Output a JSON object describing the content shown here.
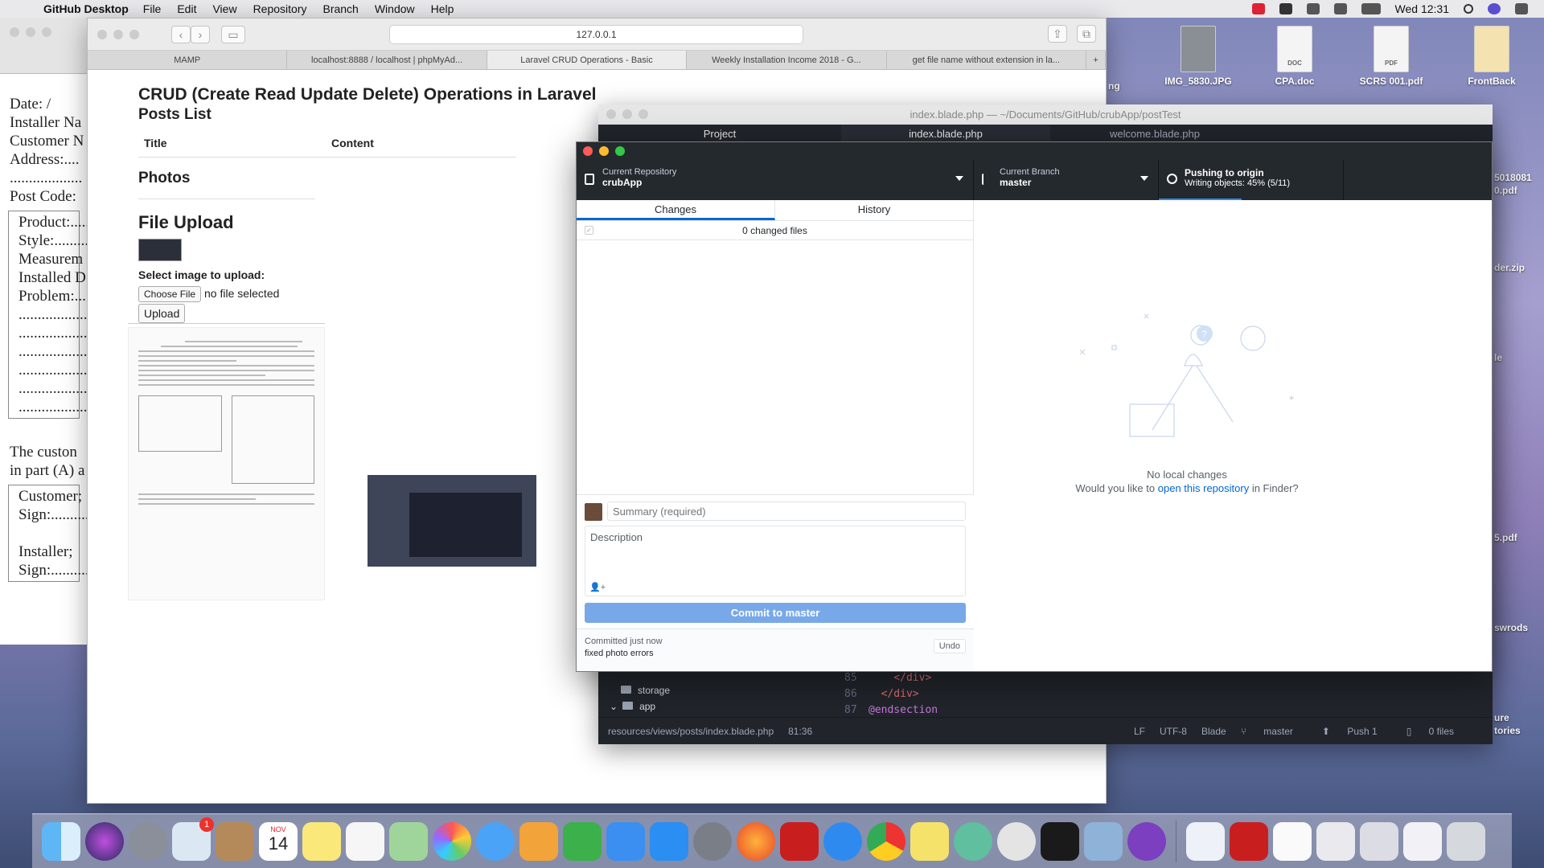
{
  "menubar": {
    "app_name": "GitHub Desktop",
    "menus": [
      "File",
      "Edit",
      "View",
      "Repository",
      "Branch",
      "Window",
      "Help"
    ],
    "clock": "Wed 12:31"
  },
  "desktop_icons": [
    {
      "label": "IMG_5830.JPG",
      "kind": "image"
    },
    {
      "label": "CPA.doc",
      "kind": "DOC"
    },
    {
      "label": "SCRS 001.pdf",
      "kind": "PDF"
    },
    {
      "label": "FrontBack",
      "kind": "app"
    }
  ],
  "desktop_edge_labels": [
    "ng",
    "5018081",
    "0.pdf",
    "der.zip",
    "le",
    "5.pdf",
    "swrods",
    "ure",
    "tories"
  ],
  "doc_window": {
    "lines_top": [
      "Date:     /",
      "Installer Na",
      "Customer N",
      "Address:....",
      "...................",
      "Post Code:"
    ],
    "lines_box": [
      "Product:.....",
      "Style:..........",
      "Measurem",
      "Installed D",
      "Problem:....",
      "...................",
      "...................",
      "...................",
      "...................",
      "...................",
      "..................."
    ],
    "lines_bottom": [
      "The custon",
      "in part (A) a"
    ],
    "lines_box2": [
      "Customer;",
      "Sign:............",
      "",
      "Installer;",
      "Sign:............"
    ]
  },
  "safari": {
    "url": "127.0.0.1",
    "tabs": [
      "MAMP",
      "localhost:8888 / localhost | phpMyAd...",
      "Laravel CRUD Operations - Basic",
      "Weekly Installation Income 2018 - G...",
      "get file name without extension in la..."
    ],
    "page": {
      "heading": "CRUD (Create Read Update Delete) Operations in Laravel",
      "posts_title": "Posts List",
      "col_title": "Title",
      "col_content": "Content",
      "photos_title": "Photos",
      "upload_title": "File Upload",
      "select_label": "Select image to upload:",
      "choose_button": "Choose File",
      "no_file": "no file selected",
      "upload_button": "Upload"
    }
  },
  "atom": {
    "title": "index.blade.php — ~/Documents/GitHub/crubApp/postTest",
    "tabs": [
      "Project",
      "index.blade.php",
      "welcome.blade.php"
    ],
    "tree": [
      "storage",
      "app"
    ],
    "code": [
      {
        "line": "85",
        "text": "    </div>"
      },
      {
        "line": "86",
        "text": "  </div>"
      },
      {
        "line": "87",
        "text": "@endsection"
      }
    ],
    "status": {
      "path": "resources/views/posts/index.blade.php",
      "cursor": "81:36",
      "eol": "LF",
      "encoding": "UTF-8",
      "grammar": "Blade",
      "branch": "master",
      "push": "Push 1",
      "files": "0 files"
    }
  },
  "github_desktop": {
    "repo_label": "Current Repository",
    "repo_value": "crubApp",
    "branch_label": "Current Branch",
    "branch_value": "master",
    "push_label": "Pushing to origin",
    "push_value": "Writing objects: 45% (5/11)",
    "push_progress_percent": 45,
    "tabs": [
      "Changes",
      "History"
    ],
    "changed_files": "0 changed files",
    "summary_placeholder": "Summary (required)",
    "description_placeholder": "Description",
    "commit_button": "Commit to master",
    "last_commit_time": "Committed just now",
    "last_commit_message": "fixed photo errors",
    "undo_button": "Undo",
    "empty_title": "No local changes",
    "empty_question_prefix": "Would you like to",
    "empty_question_link": "open this repository",
    "empty_question_suffix": "in Finder?"
  },
  "dock": {
    "calendar_month": "NOV",
    "calendar_day": "14",
    "mail_badge": "1",
    "apps": [
      "finder",
      "siri",
      "launchpad",
      "mail",
      "contacts",
      "calendar",
      "notes",
      "reminders",
      "maps",
      "photos",
      "messages",
      "pages",
      "numbers",
      "keynote",
      "app-store",
      "system-preferences",
      "firefox",
      "acrobat",
      "safari",
      "chrome",
      "stickies",
      "atom",
      "sequel-pro",
      "terminal",
      "preview",
      "github-desktop"
    ]
  },
  "colors": {
    "ghd_toolbar": "#24292e",
    "ghd_link": "#0366d6",
    "commit_button": "#79a8e8",
    "atom_bg": "#21252b"
  }
}
